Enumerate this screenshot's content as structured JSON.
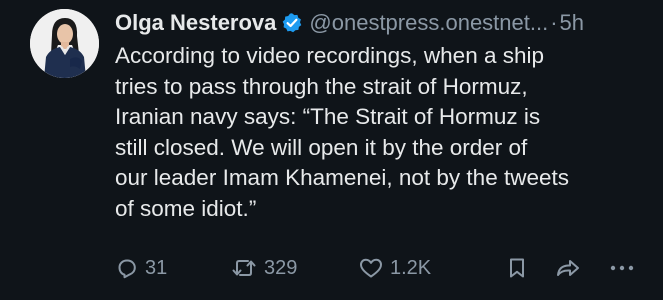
{
  "post": {
    "author": {
      "name": "Olga Nesterova",
      "handle": "@onestpress.onestnet...",
      "verified": true
    },
    "separator": "·",
    "time": "5h",
    "text": "According to video recordings, when a ship\ntries to pass through the strait of Hormuz,\nIranian navy says: “The Strait of Hormuz is\nstill closed. We will open it by the order of\nour leader Imam Khamenei, not by the tweets\nof some idiot.”"
  },
  "actions": {
    "replies": "31",
    "reposts": "329",
    "likes": "1.2K"
  },
  "icons": {
    "reply": "reply-icon",
    "repost": "repost-icon",
    "like": "heart-icon",
    "bookmark": "bookmark-icon",
    "share": "share-icon",
    "more": "more-icon",
    "verified": "verified-badge-icon"
  },
  "colors": {
    "background": "#0f1419",
    "text_primary": "#e7e9ea",
    "text_secondary": "#8b98a5",
    "verified_blue": "#1d9bf0"
  }
}
